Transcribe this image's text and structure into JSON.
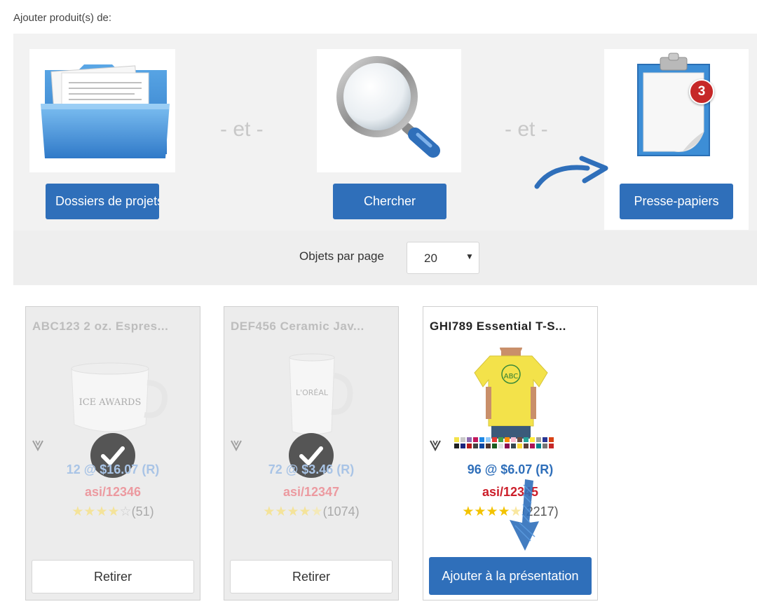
{
  "header": {
    "title": "Ajouter produit(s) de:"
  },
  "sources": {
    "separator": "- et -",
    "folders": {
      "label": "Dossiers de projets",
      "icon": "folder-icon"
    },
    "search": {
      "label": "Chercher",
      "icon": "magnifier-icon"
    },
    "clipboard": {
      "label": "Presse-papiers",
      "icon": "clipboard-icon",
      "badge_count": "3"
    }
  },
  "pagination": {
    "label": "Objets par page",
    "selected": "20"
  },
  "products": [
    {
      "title": "ABC123 2 oz. Espres...",
      "image": "espresso-cup-image",
      "image_text": "ICE AWARDS",
      "price": "12 @ $16.07 (R)",
      "sku": "asi/12346",
      "rating": 4,
      "reviews": "(51)",
      "in_presentation": true,
      "action_label": "Retirer"
    },
    {
      "title": "DEF456 Ceramic Jav...",
      "image": "ceramic-mug-image",
      "image_text": "L'ORÉAL",
      "price": "72 @ $3.46 (R)",
      "sku": "asi/12347",
      "rating": 4.5,
      "reviews": "(1074)",
      "in_presentation": true,
      "action_label": "Retirer"
    },
    {
      "title": "GHI789 Essential T-S...",
      "image": "yellow-tshirt-image",
      "image_text": "ABC",
      "price": "96 @ $6.07 (R)",
      "sku": "asi/12345",
      "rating": 4.5,
      "reviews": "(2217)",
      "in_presentation": false,
      "action_label": "Ajouter à la présentation"
    }
  ],
  "colors": {
    "accent": "#2f6fba",
    "badge": "#c62828",
    "sku_red": "#cc1e2a",
    "star": "#f3c300",
    "panel_bg": "#f2f2f2",
    "card_disabled_bg": "#ececec",
    "annotation_arrow": "#2f6fba"
  }
}
